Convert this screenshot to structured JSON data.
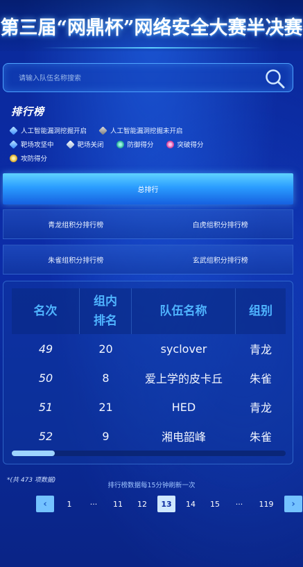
{
  "header": {
    "title": "第三届“网鼎杯”网络安全大赛半决赛"
  },
  "search": {
    "placeholder": "请输入队伍名称搜索"
  },
  "legend": {
    "title": "排行榜",
    "items": [
      {
        "label": "人工智能漏洞挖掘开启",
        "icon": "cube-blue-icon"
      },
      {
        "label": "人工智能漏洞挖掘未开启",
        "icon": "cube-gray-icon"
      },
      {
        "label": "靶场攻坚中",
        "icon": "cube-blue-icon"
      },
      {
        "label": "靶场关闭",
        "icon": "cube-white-icon"
      },
      {
        "label": "防御得分",
        "icon": "teal-dot-icon"
      },
      {
        "label": "突破得分",
        "icon": "pink-dot-icon"
      },
      {
        "label": "攻防得分",
        "icon": "gold-dot-icon"
      }
    ]
  },
  "tabs": {
    "total": "总排行",
    "groups": [
      "青龙组积分排行榜",
      "白虎组积分排行榜",
      "朱雀组积分排行榜",
      "玄武组积分排行榜"
    ]
  },
  "table": {
    "headers": [
      "名次",
      "组内\n排名",
      "队伍名称",
      "组别"
    ],
    "rows": [
      {
        "rank": "49",
        "group_rank": "20",
        "team": "syclover",
        "group": "青龙"
      },
      {
        "rank": "50",
        "group_rank": "8",
        "team": "爱上学的皮卡丘",
        "group": "朱雀"
      },
      {
        "rank": "51",
        "group_rank": "21",
        "team": "HED",
        "group": "青龙"
      },
      {
        "rank": "52",
        "group_rank": "9",
        "team": "湘电韶峰",
        "group": "朱雀"
      }
    ]
  },
  "footer": {
    "total_note": "*(共 473 项数据)",
    "refresh_note": "排行榜数据每15分钟刷新一次"
  },
  "pagination": {
    "prev": "‹",
    "next": "›",
    "pages": [
      "1",
      "···",
      "11",
      "12",
      "13",
      "14",
      "15",
      "···",
      "119"
    ],
    "current": "13"
  },
  "colors": {
    "accent": "#4fb4ff",
    "background": "#0b2aa0",
    "active_tab": "#2a9cff"
  }
}
